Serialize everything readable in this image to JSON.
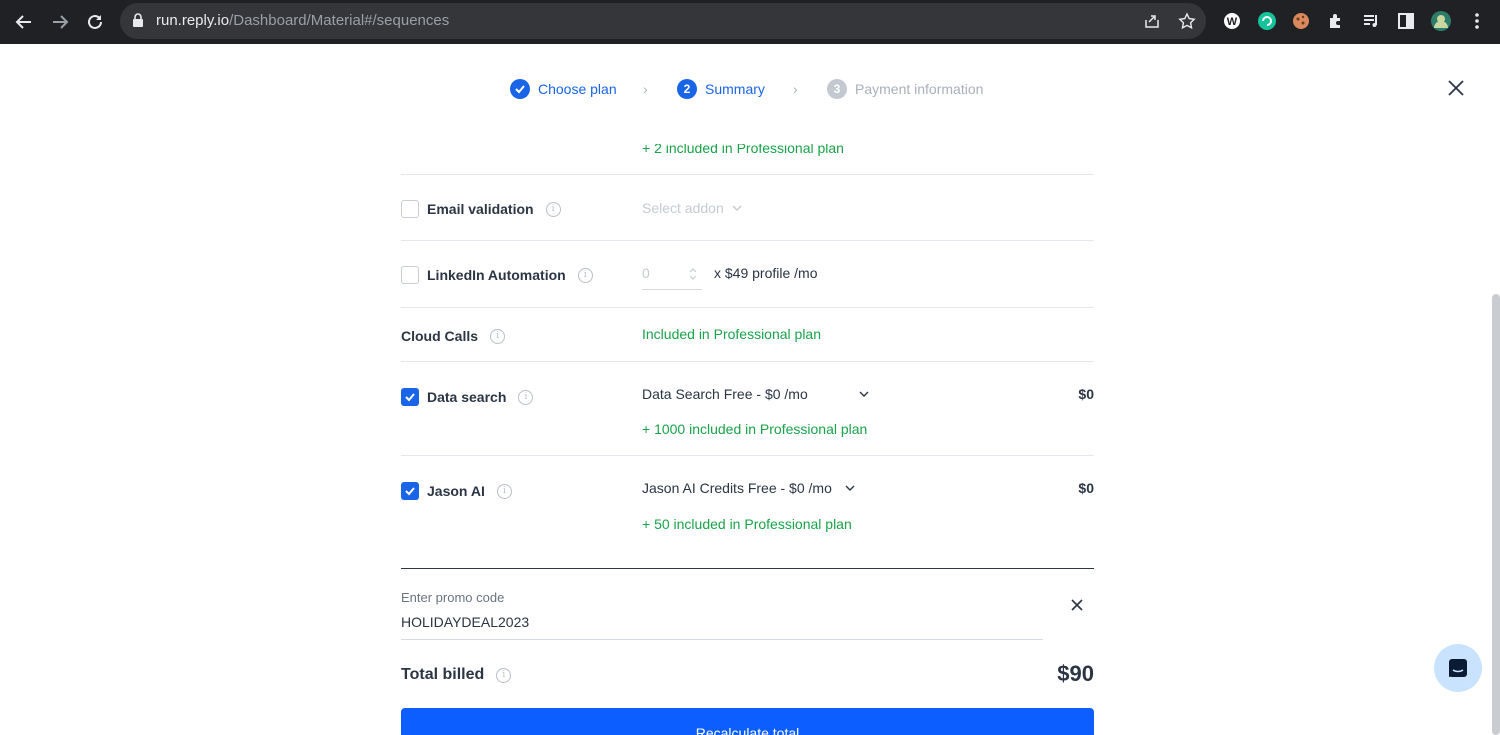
{
  "browser": {
    "url_host": "run.reply.io",
    "url_path": "/Dashboard/Material#/sequences"
  },
  "stepper": {
    "steps": [
      {
        "number": "1",
        "label": "Choose plan",
        "state": "done"
      },
      {
        "number": "2",
        "label": "Summary",
        "state": "active"
      },
      {
        "number": "3",
        "label": "Payment information",
        "state": "pending"
      }
    ]
  },
  "addons": {
    "top_note": "+ 2 included in Professional plan",
    "email_validation": {
      "label": "Email validation",
      "checked": false,
      "select_placeholder": "Select addon"
    },
    "linkedin": {
      "label": "LinkedIn Automation",
      "checked": false,
      "quantity": "0",
      "unit_price": "x $49 profile /mo"
    },
    "cloud_calls": {
      "label": "Cloud Calls",
      "note": "Included in Professional plan"
    },
    "data_search": {
      "label": "Data search",
      "checked": true,
      "selected": "Data Search Free - $0 /mo",
      "note": "+ 1000 included in Professional plan",
      "price": "$0"
    },
    "jason_ai": {
      "label": "Jason AI",
      "checked": true,
      "selected": "Jason AI Credits Free - $0 /mo",
      "note": "+ 50 included in Professional plan",
      "price": "$0"
    }
  },
  "promo": {
    "label": "Enter promo code",
    "value": "HOLIDAYDEAL2023"
  },
  "total": {
    "label": "Total billed",
    "value": "$90"
  },
  "actions": {
    "recalculate_label": "Recalculate total"
  },
  "colors": {
    "accent": "#1a64e8",
    "button": "#0d5eff",
    "green": "#1aa34a"
  }
}
